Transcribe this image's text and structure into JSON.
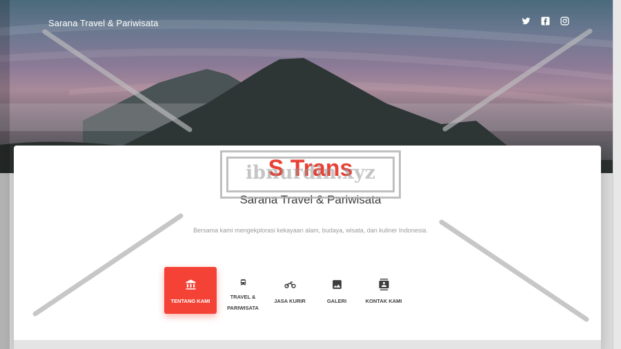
{
  "header": {
    "brand": "Sarana Travel & Pariwisata",
    "social": [
      {
        "icon": "twitter-icon"
      },
      {
        "icon": "facebook-icon"
      },
      {
        "icon": "instagram-icon"
      }
    ]
  },
  "main": {
    "title": "S Trans",
    "subtitle": "Sarana Travel & Pariwisata",
    "description": "Bersama kami mengekplorasi kekayaan alam, budaya, wisata, dan kuliner Indonesia."
  },
  "nav": {
    "items": [
      {
        "label": "TENTANG KAMI",
        "icon": "bank-icon",
        "active": true
      },
      {
        "label": "TRAVEL & PARIWISATA",
        "icon": "bus-icon",
        "active": false
      },
      {
        "label": "JASA KURIR",
        "icon": "motorcycle-icon",
        "active": false
      },
      {
        "label": "GALERI",
        "icon": "image-icon",
        "active": false
      },
      {
        "label": "KONTAK KAMI",
        "icon": "contact-icon",
        "active": false
      }
    ]
  },
  "watermark": {
    "text": "ibnurdin.xyz"
  },
  "colors": {
    "accent": "#f44336",
    "title": "#e84237"
  }
}
